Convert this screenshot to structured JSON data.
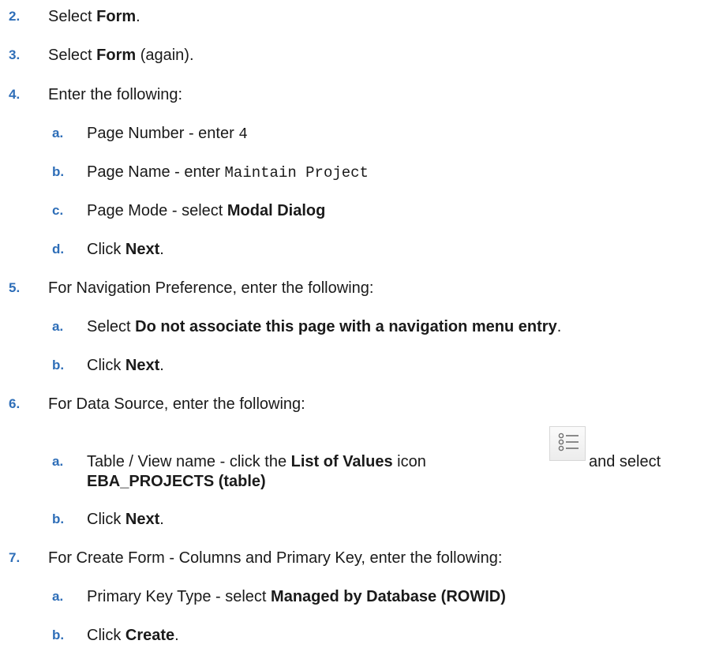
{
  "steps": [
    {
      "num": "2.",
      "parts": [
        "Select ",
        "Form",
        "."
      ]
    },
    {
      "num": "3.",
      "parts": [
        "Select ",
        "Form",
        " (again)."
      ]
    },
    {
      "num": "4.",
      "text": "Enter the following:"
    },
    {
      "num": "a.",
      "label": "Page Number - enter ",
      "code": "4"
    },
    {
      "num": "b.",
      "label": "Page Name - enter ",
      "code": "Maintain Project"
    },
    {
      "num": "c.",
      "parts": [
        "Page Mode - select ",
        "Modal Dialog",
        ""
      ]
    },
    {
      "num": "d.",
      "parts": [
        "Click ",
        "Next",
        "."
      ]
    },
    {
      "num": "5.",
      "text": "For Navigation Preference, enter the following:"
    },
    {
      "num": "a.",
      "parts": [
        "Select ",
        "Do not associate this page with a navigation menu entry",
        "."
      ]
    },
    {
      "num": "b.",
      "parts": [
        "Click ",
        "Next",
        "."
      ]
    },
    {
      "num": "6.",
      "text": "For Data Source, enter the following:"
    },
    {
      "num": "a.",
      "line1": [
        "Table / View name - click the ",
        "List of Values",
        " icon",
        " and select"
      ],
      "line2": "EBA_PROJECTS (table)"
    },
    {
      "num": "b.",
      "parts": [
        "Click ",
        "Next",
        "."
      ]
    },
    {
      "num": "7.",
      "text": "For Create Form - Columns and Primary Key, enter the following:"
    },
    {
      "num": "a.",
      "parts": [
        "Primary Key Type - select ",
        "Managed by Database (ROWID)",
        ""
      ]
    },
    {
      "num": "b.",
      "parts": [
        "Click ",
        "Create",
        "."
      ]
    }
  ],
  "icons": {
    "lov": "list-of-values-icon"
  }
}
